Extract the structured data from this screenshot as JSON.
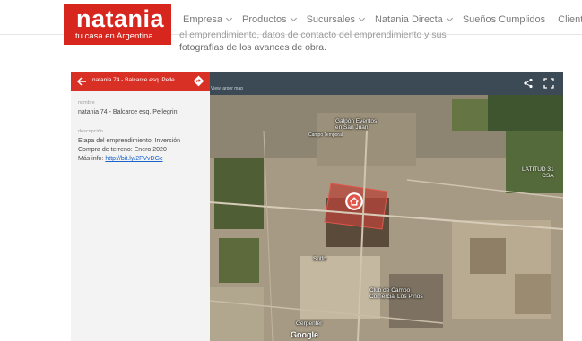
{
  "brand": {
    "name": "natania",
    "tagline": "tu casa en Argentina",
    "color": "#d7261d"
  },
  "nav": {
    "items": [
      {
        "label": "Empresa",
        "has_dropdown": true
      },
      {
        "label": "Productos",
        "has_dropdown": true
      },
      {
        "label": "Sucursales",
        "has_dropdown": true
      },
      {
        "label": "Natania Directa",
        "has_dropdown": true
      },
      {
        "label": "Sueños Cumplidos",
        "has_dropdown": false
      },
      {
        "label": "Clientes",
        "has_dropdown": false
      }
    ]
  },
  "intro": {
    "line1": "el emprendimiento, datos de contacto del emprendimiento y sus",
    "line2": "fotografías de los avances de obra."
  },
  "map_embed": {
    "title": "natania 74 - Balcarce esq. Pelle...",
    "view_larger": "View larger map",
    "accent": "#d93025",
    "panel": {
      "name_label": "nombre",
      "name_value": "natania 74 - Balcarce esq. Pellegrini",
      "desc_label": "descripción",
      "desc_line1": "Etapa del emprendimiento: Inversión",
      "desc_line2": "Compra de terreno: Enero 2020",
      "desc_line3_prefix": "Más info: ",
      "desc_link": "http://bit.ly/2FVvDGc"
    },
    "map_labels": {
      "galpon": "Galpón Eventos\nen San Juan",
      "campus": "Campo Temporal",
      "sulfo": "Sulfo",
      "club": "Club de Campo\nComercial Los Pinos",
      "latitude": "LATITUD 31\nCSA",
      "gerpenter": "Gerpenter"
    },
    "google": "Google",
    "icons": {
      "back": "back-arrow-icon",
      "directions": "directions-icon",
      "share": "share-icon",
      "fullscreen": "fullscreen-icon",
      "marker": "home-marker-icon"
    }
  }
}
